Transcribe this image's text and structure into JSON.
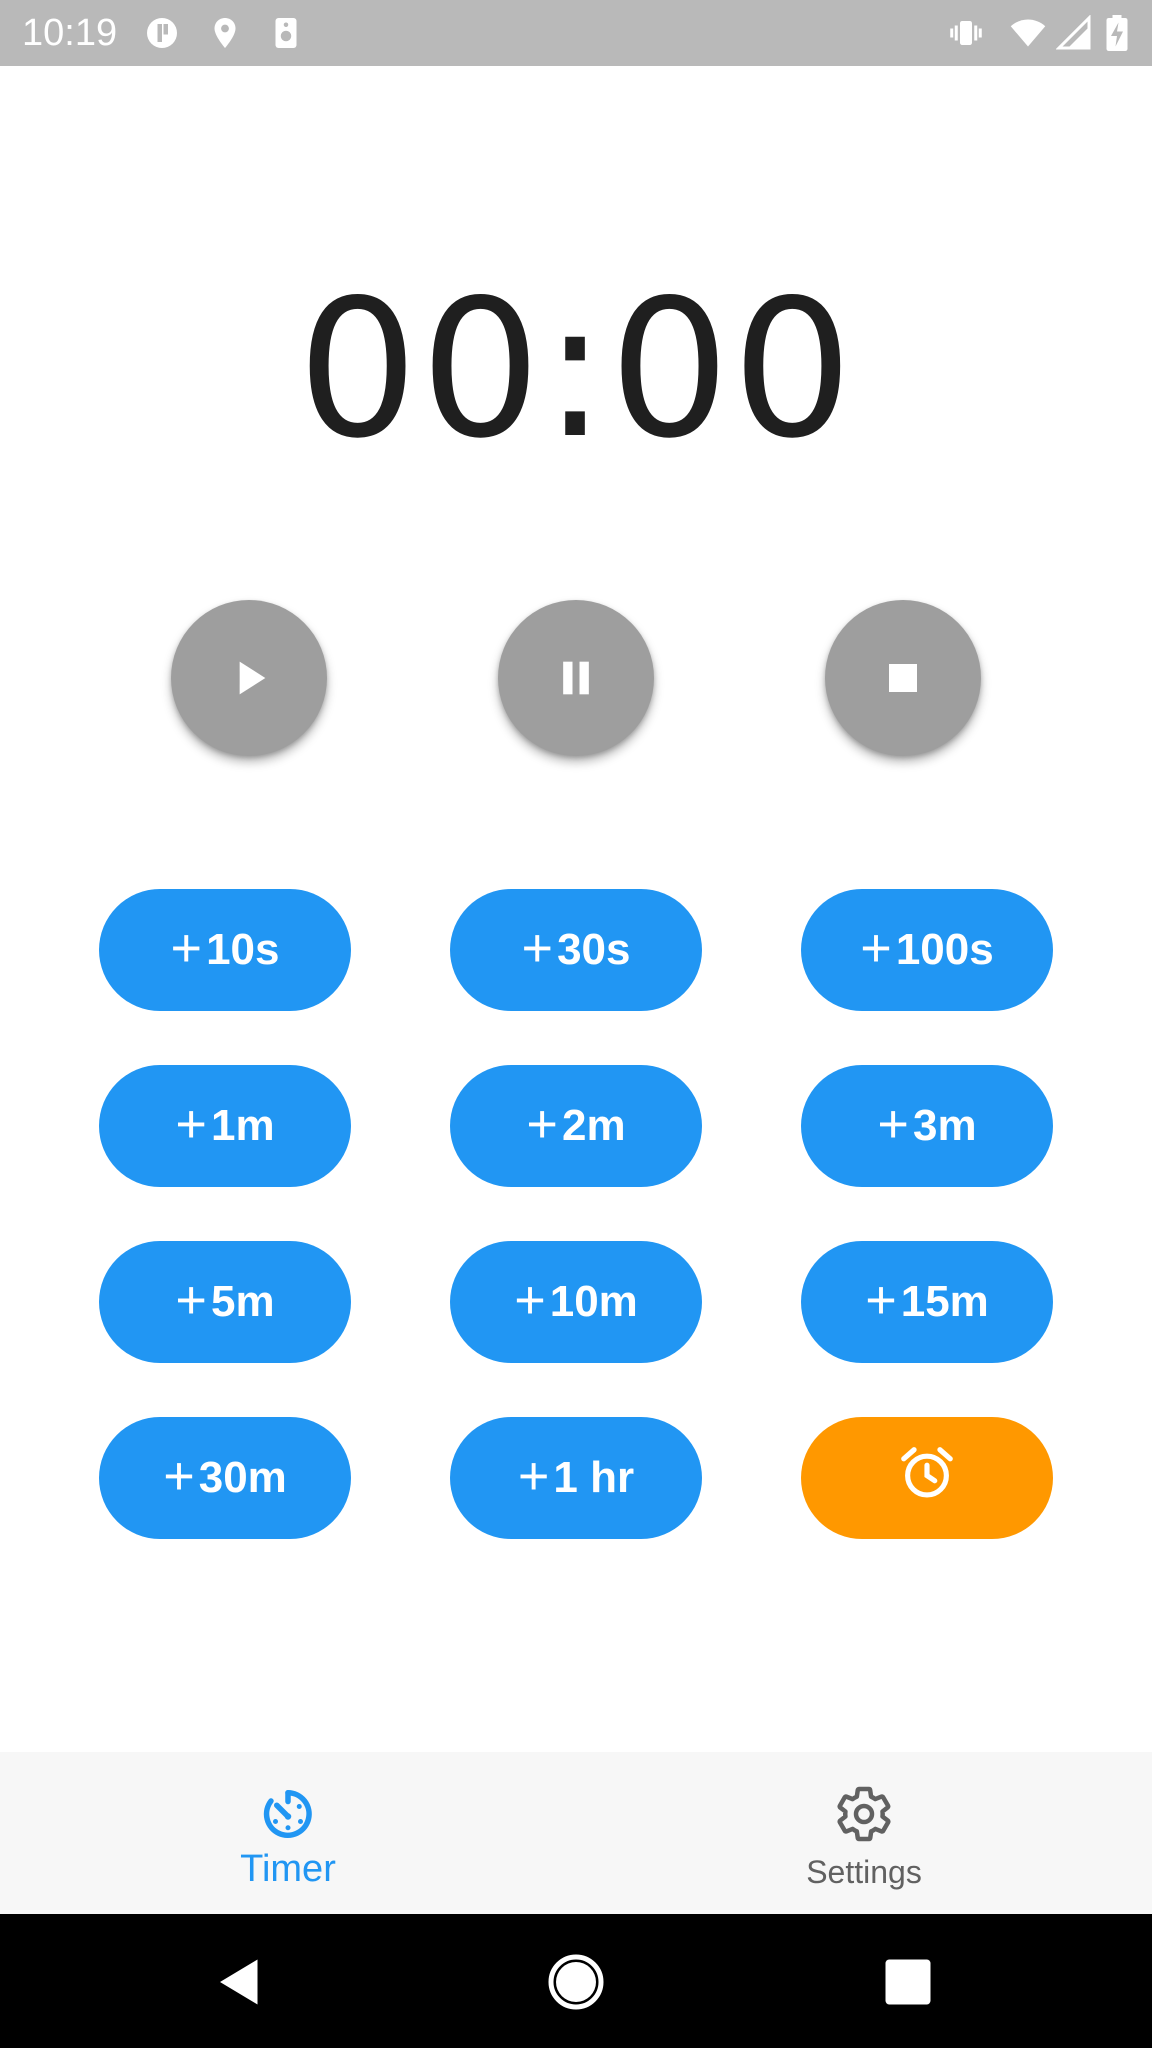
{
  "status_bar": {
    "time": "10:19",
    "left_icons": [
      "data-saver-icon",
      "location-icon",
      "speaker-icon"
    ],
    "right_icons": [
      "vibrate-icon",
      "wifi-icon",
      "signal-icon",
      "battery-charging-icon"
    ]
  },
  "timer": {
    "display": "00:00"
  },
  "controls": {
    "play_icon": "play-icon",
    "pause_icon": "pause-icon",
    "stop_icon": "stop-icon"
  },
  "add_buttons": [
    {
      "plus": "+",
      "label": "10s"
    },
    {
      "plus": "+",
      "label": "30s"
    },
    {
      "plus": "+",
      "label": "100s"
    },
    {
      "plus": "+",
      "label": "1m"
    },
    {
      "plus": "+",
      "label": "2m"
    },
    {
      "plus": "+",
      "label": "3m"
    },
    {
      "plus": "+",
      "label": "5m"
    },
    {
      "plus": "+",
      "label": "10m"
    },
    {
      "plus": "+",
      "label": "15m"
    },
    {
      "plus": "+",
      "label": "30m"
    },
    {
      "plus": "+",
      "label": "1 hr"
    }
  ],
  "alarm_button": {
    "icon": "alarm-clock-icon"
  },
  "bottom_nav": {
    "items": [
      {
        "label": "Timer",
        "icon": "timer-icon",
        "active": true
      },
      {
        "label": "Settings",
        "icon": "gear-icon",
        "active": false
      }
    ]
  },
  "colors": {
    "accent": "#2196f3",
    "alarm": "#ff9800",
    "control": "#9e9e9e",
    "status_bar": "#b9b9b9"
  },
  "system_nav": [
    "back-icon",
    "home-icon",
    "recents-icon"
  ]
}
